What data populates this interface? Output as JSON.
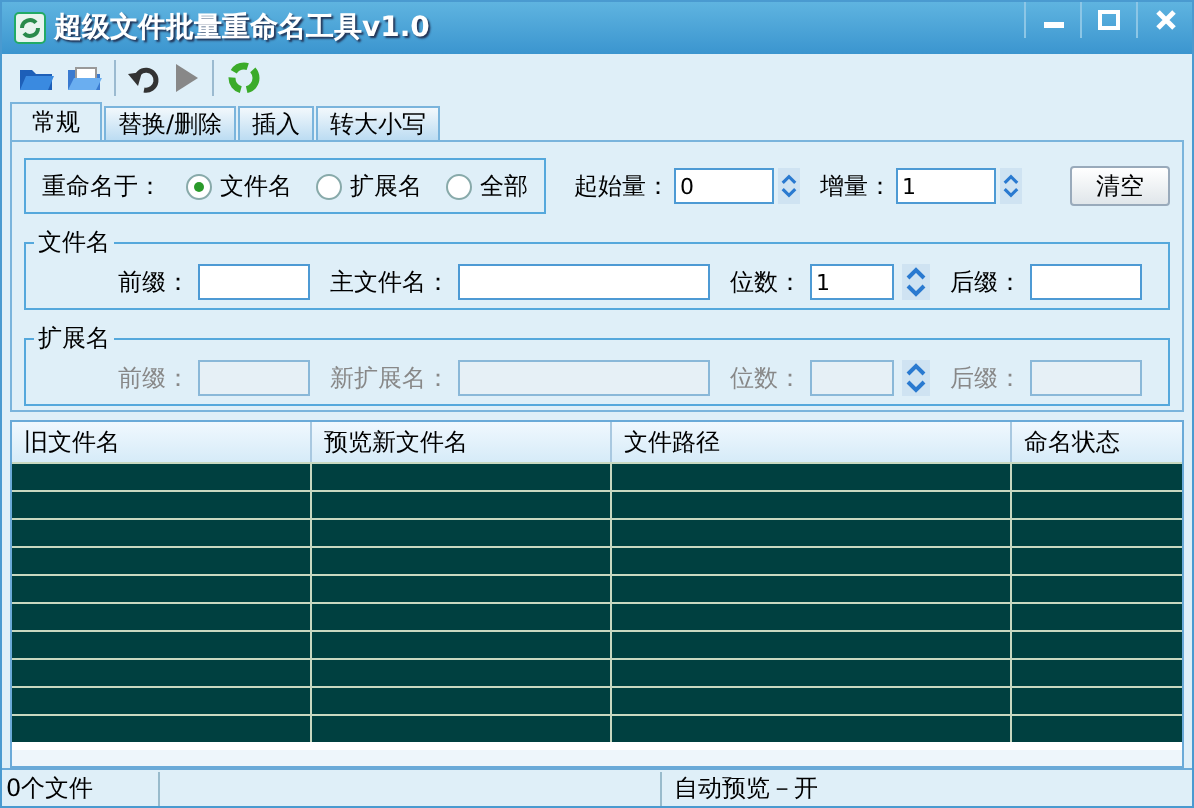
{
  "window": {
    "title": "超级文件批量重命名工具v1.0"
  },
  "tabs": [
    {
      "label": "常规",
      "selected": true
    },
    {
      "label": "替换/删除",
      "selected": false
    },
    {
      "label": "插入",
      "selected": false
    },
    {
      "label": "转大小写",
      "selected": false
    }
  ],
  "rename_target": {
    "label": "重命名于：",
    "options": [
      {
        "label": "文件名",
        "selected": true
      },
      {
        "label": "扩展名",
        "selected": false
      },
      {
        "label": "全部",
        "selected": false
      }
    ]
  },
  "start": {
    "label": "起始量：",
    "value": "0"
  },
  "increment": {
    "label": "增量：",
    "value": "1"
  },
  "clear_button": "清空",
  "groups": [
    {
      "title": "文件名",
      "disabled": false,
      "fields": [
        {
          "kind": "text",
          "label": "前缀："
        },
        {
          "kind": "wide",
          "label": "主文件名："
        },
        {
          "kind": "spin",
          "label": "位数：",
          "value": "1"
        },
        {
          "kind": "text",
          "label": "后缀："
        }
      ]
    },
    {
      "title": "扩展名",
      "disabled": true,
      "fields": [
        {
          "kind": "text",
          "label": "前缀："
        },
        {
          "kind": "wide",
          "label": "新扩展名："
        },
        {
          "kind": "spin",
          "label": "位数："
        },
        {
          "kind": "text",
          "label": "后缀："
        }
      ]
    }
  ],
  "table": {
    "columns": [
      "旧文件名",
      "预览新文件名",
      "文件路径",
      "命名状态"
    ]
  },
  "status_bar": {
    "file_count": "0个文件",
    "auto_preview": "自动预览－开"
  }
}
